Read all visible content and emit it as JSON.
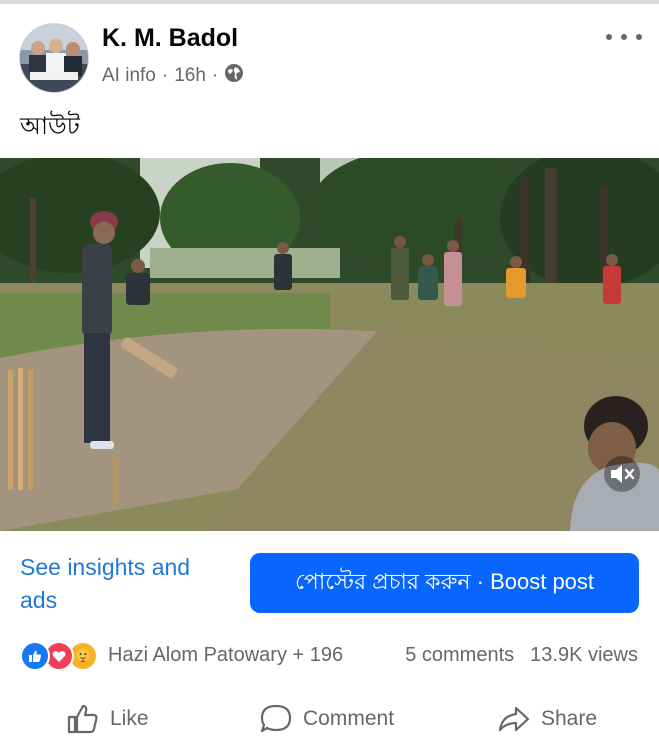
{
  "post": {
    "author": "K. M. Badol",
    "meta": {
      "ai_info": "AI info",
      "separator": "·",
      "time": "16h",
      "audience_icon": "globe-icon"
    },
    "more_icon": "more-horizontal-icon",
    "caption": "আউট"
  },
  "media": {
    "description_icon": "video",
    "mute_icon": "speaker-muted-icon"
  },
  "insights": {
    "link_label": "See insights and ads",
    "boost_label": "পোস্টের প্রচার করুন · Boost post"
  },
  "engagement": {
    "reaction_icons": [
      "like-reaction-icon",
      "love-reaction-icon",
      "care-reaction-icon"
    ],
    "reactors": "Hazi Alom Patowary + 196",
    "comments": "5 comments",
    "views": "13.9K views"
  },
  "actions": {
    "like": "Like",
    "comment": "Comment",
    "share": "Share"
  },
  "colors": {
    "accent": "#0866ff",
    "link": "#2178d8",
    "muted_text": "#65676b"
  }
}
